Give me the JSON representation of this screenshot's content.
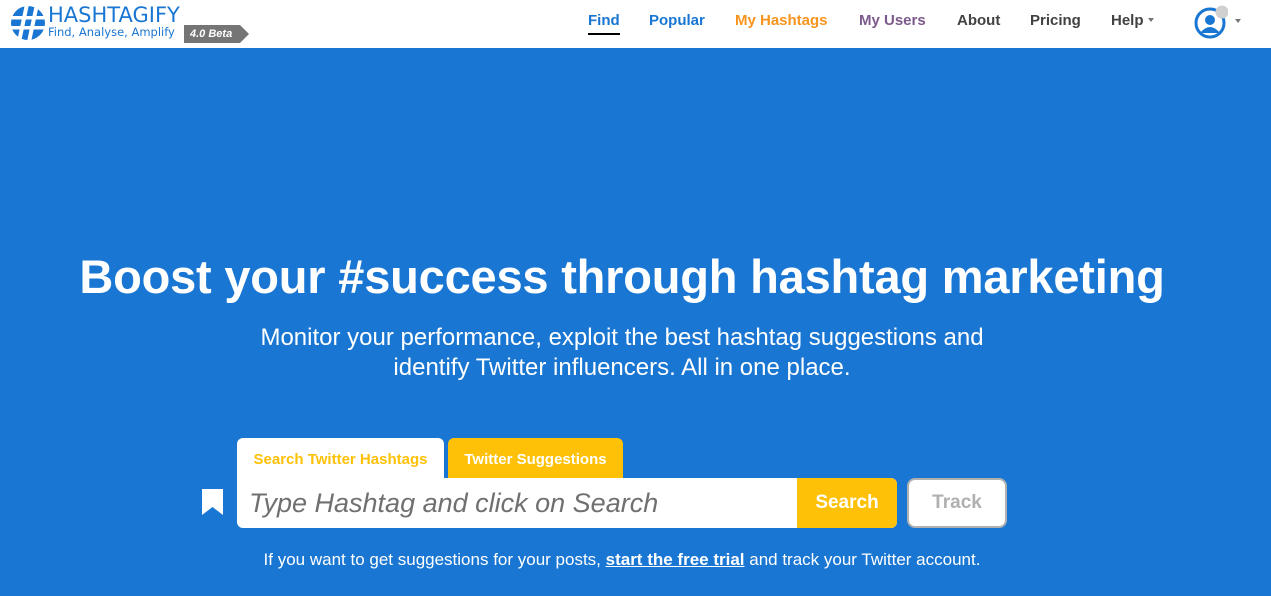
{
  "header": {
    "logo": {
      "name": "HASHTAGIFY",
      "tagline": "Find, Analyse, Amplify",
      "badge": "4.0 Beta"
    },
    "nav": [
      {
        "label": "Find",
        "color": "#1976d2",
        "active": true
      },
      {
        "label": "Popular",
        "color": "#1976d2",
        "active": false
      },
      {
        "label": "My Hashtags",
        "color": "#f7941d",
        "active": false
      },
      {
        "label": "My Users",
        "color": "#7b5a8c",
        "active": false
      },
      {
        "label": "About",
        "color": "#424242",
        "active": false
      },
      {
        "label": "Pricing",
        "color": "#424242",
        "active": false
      },
      {
        "label": "Help",
        "color": "#424242",
        "active": false,
        "dropdown": true
      }
    ],
    "account_icon": "user-circle-icon"
  },
  "hero": {
    "title": "Boost your #success through hashtag marketing",
    "subtitle_line1": "Monitor your performance, exploit the best hashtag suggestions and",
    "subtitle_line2": "identify Twitter influencers. All in one place."
  },
  "search": {
    "tabs": [
      {
        "label": "Search Twitter Hashtags",
        "active": true
      },
      {
        "label": "Twitter Suggestions",
        "active": false
      }
    ],
    "input_value": "",
    "placeholder": "Type Hashtag and click on Search",
    "search_label": "Search",
    "track_label": "Track",
    "bookmark_icon": "bookmark-icon"
  },
  "note": {
    "before": "If you want to get suggestions for your posts, ",
    "link": "start the free trial",
    "after": " and track your Twitter account."
  },
  "colors": {
    "brand_blue": "#1976d2",
    "accent_yellow": "#ffc107",
    "orange": "#f7941d",
    "purple": "#7b5a8c"
  }
}
